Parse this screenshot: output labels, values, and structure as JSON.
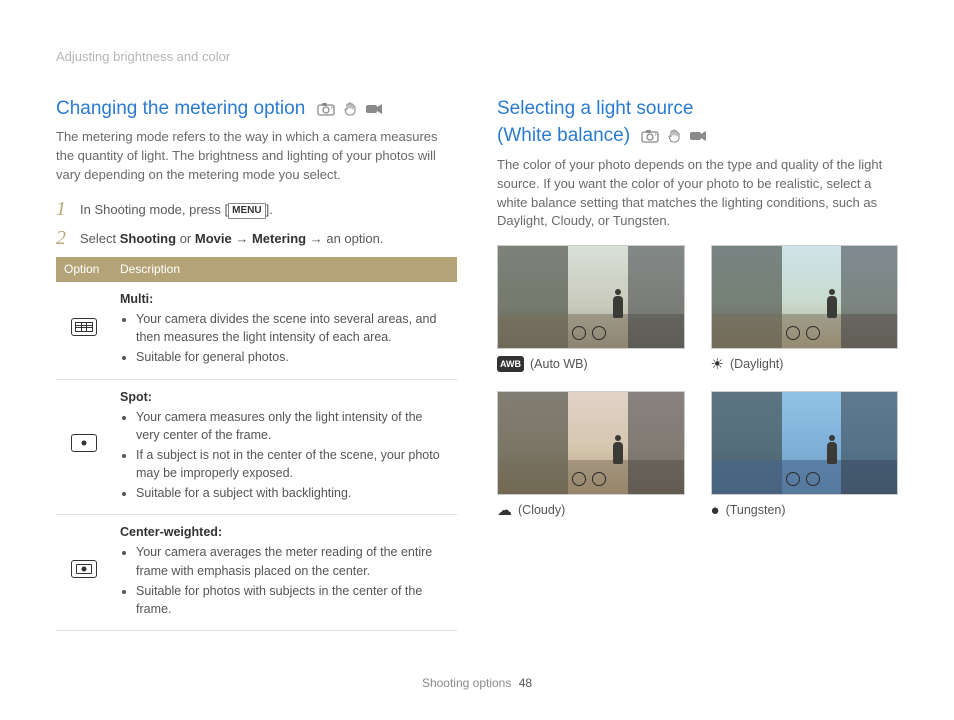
{
  "breadcrumb": "Adjusting brightness and color",
  "footer": {
    "section": "Shooting options",
    "page": "48"
  },
  "left": {
    "title": "Changing the metering option",
    "mode_icons": [
      "camera-p-icon",
      "hand-icon",
      "video-icon"
    ],
    "intro": "The metering mode refers to the way in which a camera measures the quantity of light. The brightness and lighting of your photos will vary depending on the metering mode you select.",
    "steps": [
      {
        "num": "1",
        "pre": "In Shooting mode, press [",
        "menu": "MENU",
        "post": "]."
      },
      {
        "num": "2",
        "pre": "Select ",
        "b1": "Shooting",
        "mid1": " or ",
        "b2": "Movie",
        "arrow1": " → ",
        "b3": "Metering",
        "arrow2": " → ",
        "tail": "an option."
      }
    ],
    "table": {
      "headers": [
        "Option",
        "Description"
      ],
      "rows": [
        {
          "icon": "multi",
          "title": "Multi",
          "bullets": [
            "Your camera divides the scene into several areas, and then measures the light intensity of each area.",
            "Suitable for general photos."
          ]
        },
        {
          "icon": "spot",
          "title": "Spot",
          "bullets": [
            "Your camera measures only the light intensity of the very center of the frame.",
            "If a subject is not in the center of the scene, your photo may be improperly exposed.",
            "Suitable for a subject with backlighting."
          ]
        },
        {
          "icon": "center",
          "title": "Center-weighted",
          "bullets": [
            "Your camera averages the meter reading of the entire frame with emphasis placed on the center.",
            "Suitable for photos with subjects in the center of the frame."
          ]
        }
      ]
    }
  },
  "right": {
    "title_line1": "Selecting a light source",
    "title_line2": "(White balance)",
    "mode_icons": [
      "camera-p-icon",
      "hand-icon",
      "video-icon"
    ],
    "intro": "The color of your photo depends on the type and quality of the light source. If you want the color of your photo to be realistic, select a white balance setting that matches the lighting conditions, such as Daylight, Cloudy, or Tungsten.",
    "samples": [
      {
        "key": "auto",
        "badge": "AWB",
        "glyph": "",
        "label": "(Auto WB)"
      },
      {
        "key": "daylight",
        "badge": "",
        "glyph": "☀",
        "label": "(Daylight)"
      },
      {
        "key": "cloudy",
        "badge": "",
        "glyph": "☁",
        "label": "(Cloudy)"
      },
      {
        "key": "tungsten",
        "badge": "",
        "glyph": "●",
        "label": "(Tungsten)"
      }
    ]
  }
}
